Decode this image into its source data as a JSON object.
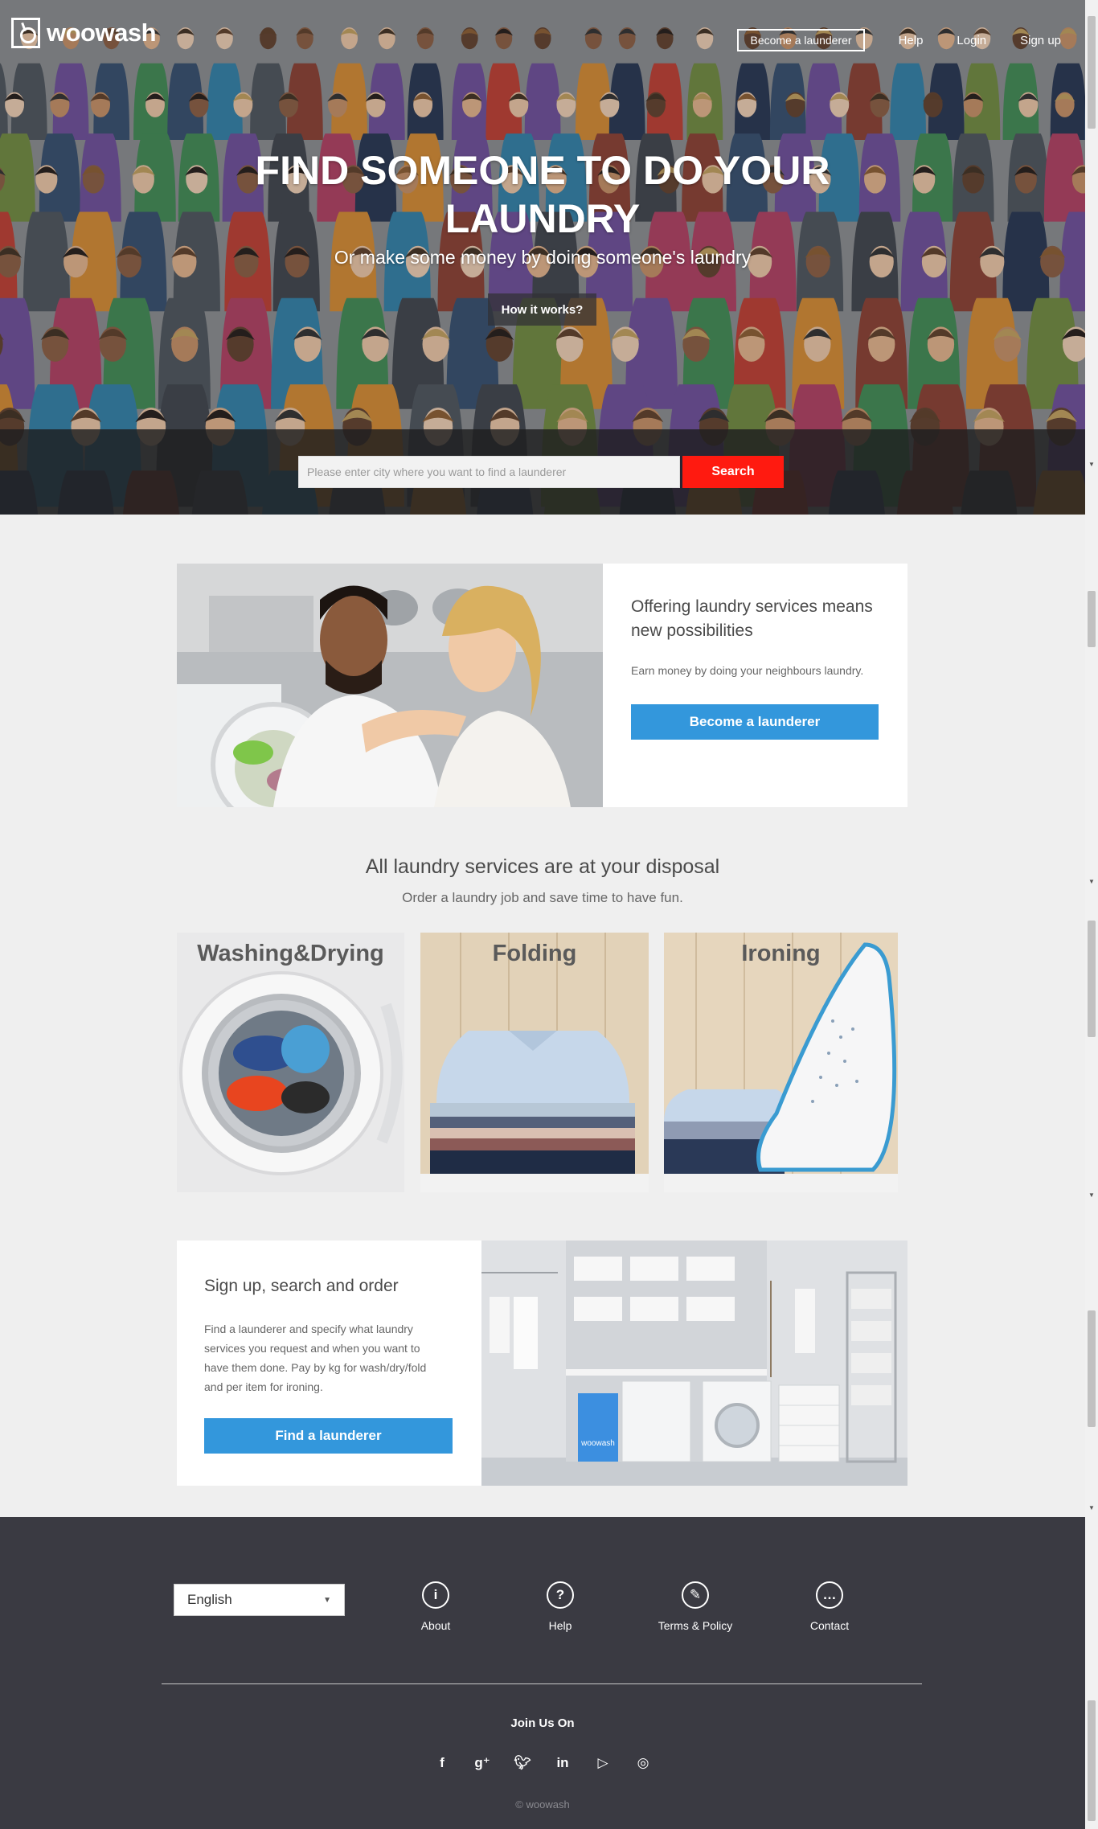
{
  "brand": {
    "name": "woowash"
  },
  "nav": {
    "become": "Become a launderer",
    "help": "Help",
    "login": "Login",
    "signup": "Sign up"
  },
  "hero": {
    "title": "FIND SOMEONE TO DO YOUR LAUNDRY",
    "subtitle": "Or make some money by doing someone's laundry",
    "how_label": "How it works?"
  },
  "search": {
    "placeholder": "Please enter city where you want to find a launderer",
    "button": "Search"
  },
  "offer": {
    "title": "Offering laundry services means new possibilities",
    "text": "Earn money by doing your neighbours laundry.",
    "button": "Become a launderer"
  },
  "services": {
    "title": "All laundry services are at your disposal",
    "subtitle": "Order a laundry job and save time to have fun.",
    "items": [
      {
        "label": "Washing&Drying"
      },
      {
        "label": "Folding"
      },
      {
        "label": "Ironing"
      }
    ]
  },
  "signup": {
    "title": "Sign up, search and order",
    "text": "Find a launderer and specify what laundry services you request and when you want to have them done. Pay by kg for wash/dry/fold and per item for ironing.",
    "button": "Find a launderer",
    "basket_label": "woowash"
  },
  "footer": {
    "language": "English",
    "links": [
      {
        "label": "About"
      },
      {
        "label": "Help"
      },
      {
        "label": "Terms & Policy"
      },
      {
        "label": "Contact"
      }
    ],
    "join": "Join Us On",
    "copyright": "© woowash"
  }
}
